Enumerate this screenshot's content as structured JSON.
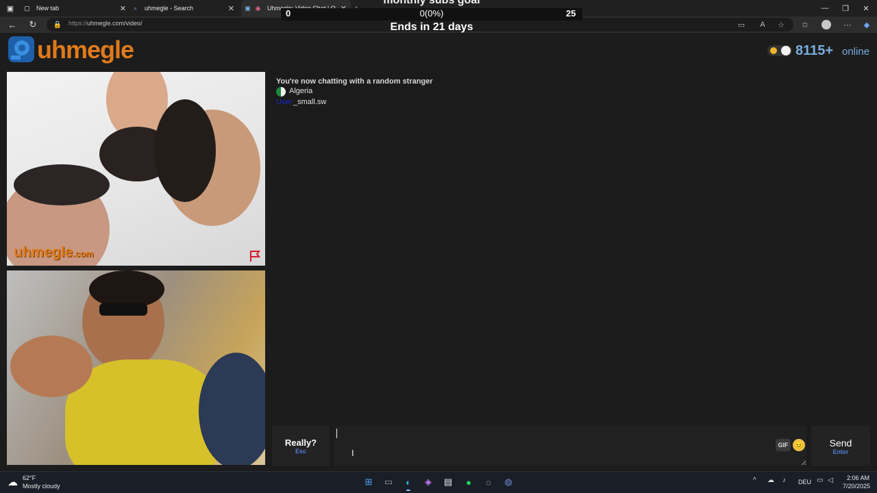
{
  "browser": {
    "tabs": [
      {
        "title": "New tab"
      },
      {
        "title": "uhmegle - Search"
      },
      {
        "title": "Uhmegle: Video Chat | Omegle"
      }
    ],
    "new_tab_symbol": "+",
    "url_prefix": "https://",
    "url_host_path": "uhmegle.com/video/",
    "window_controls": {
      "minimize": "—",
      "restore": "❐",
      "close": "✕"
    }
  },
  "overlay": {
    "title": "monthly subs goal",
    "min": "0",
    "progress_text": "0(0%)",
    "max": "25",
    "ends": "Ends in 21 days",
    "progress_fraction": 0
  },
  "site": {
    "logo_text": "uhmegle",
    "online_count": "8115+",
    "online_label": "online"
  },
  "videos": {
    "watermark_main": "uhmegle",
    "watermark_suffix": ".com"
  },
  "chat": {
    "status": "You're now chatting with a random stranger",
    "country": "Algeria",
    "user_tag": "User",
    "user_name": "_small.sw"
  },
  "composer": {
    "really_label": "Really?",
    "really_key": "Esc",
    "input_value": "",
    "gif_label": "GIF",
    "emoji": "😐",
    "send_label": "Send",
    "send_key": "Enter"
  },
  "taskbar": {
    "weather_temp": "62°F",
    "weather_desc": "Mostly cloudy",
    "language": "DEU",
    "time": "2:06 AM",
    "date": "7/20/2025"
  },
  "colors": {
    "brand_orange": "#e07a1a",
    "online_blue": "#7aaee0",
    "key_hint_blue": "#4f7bd4"
  }
}
